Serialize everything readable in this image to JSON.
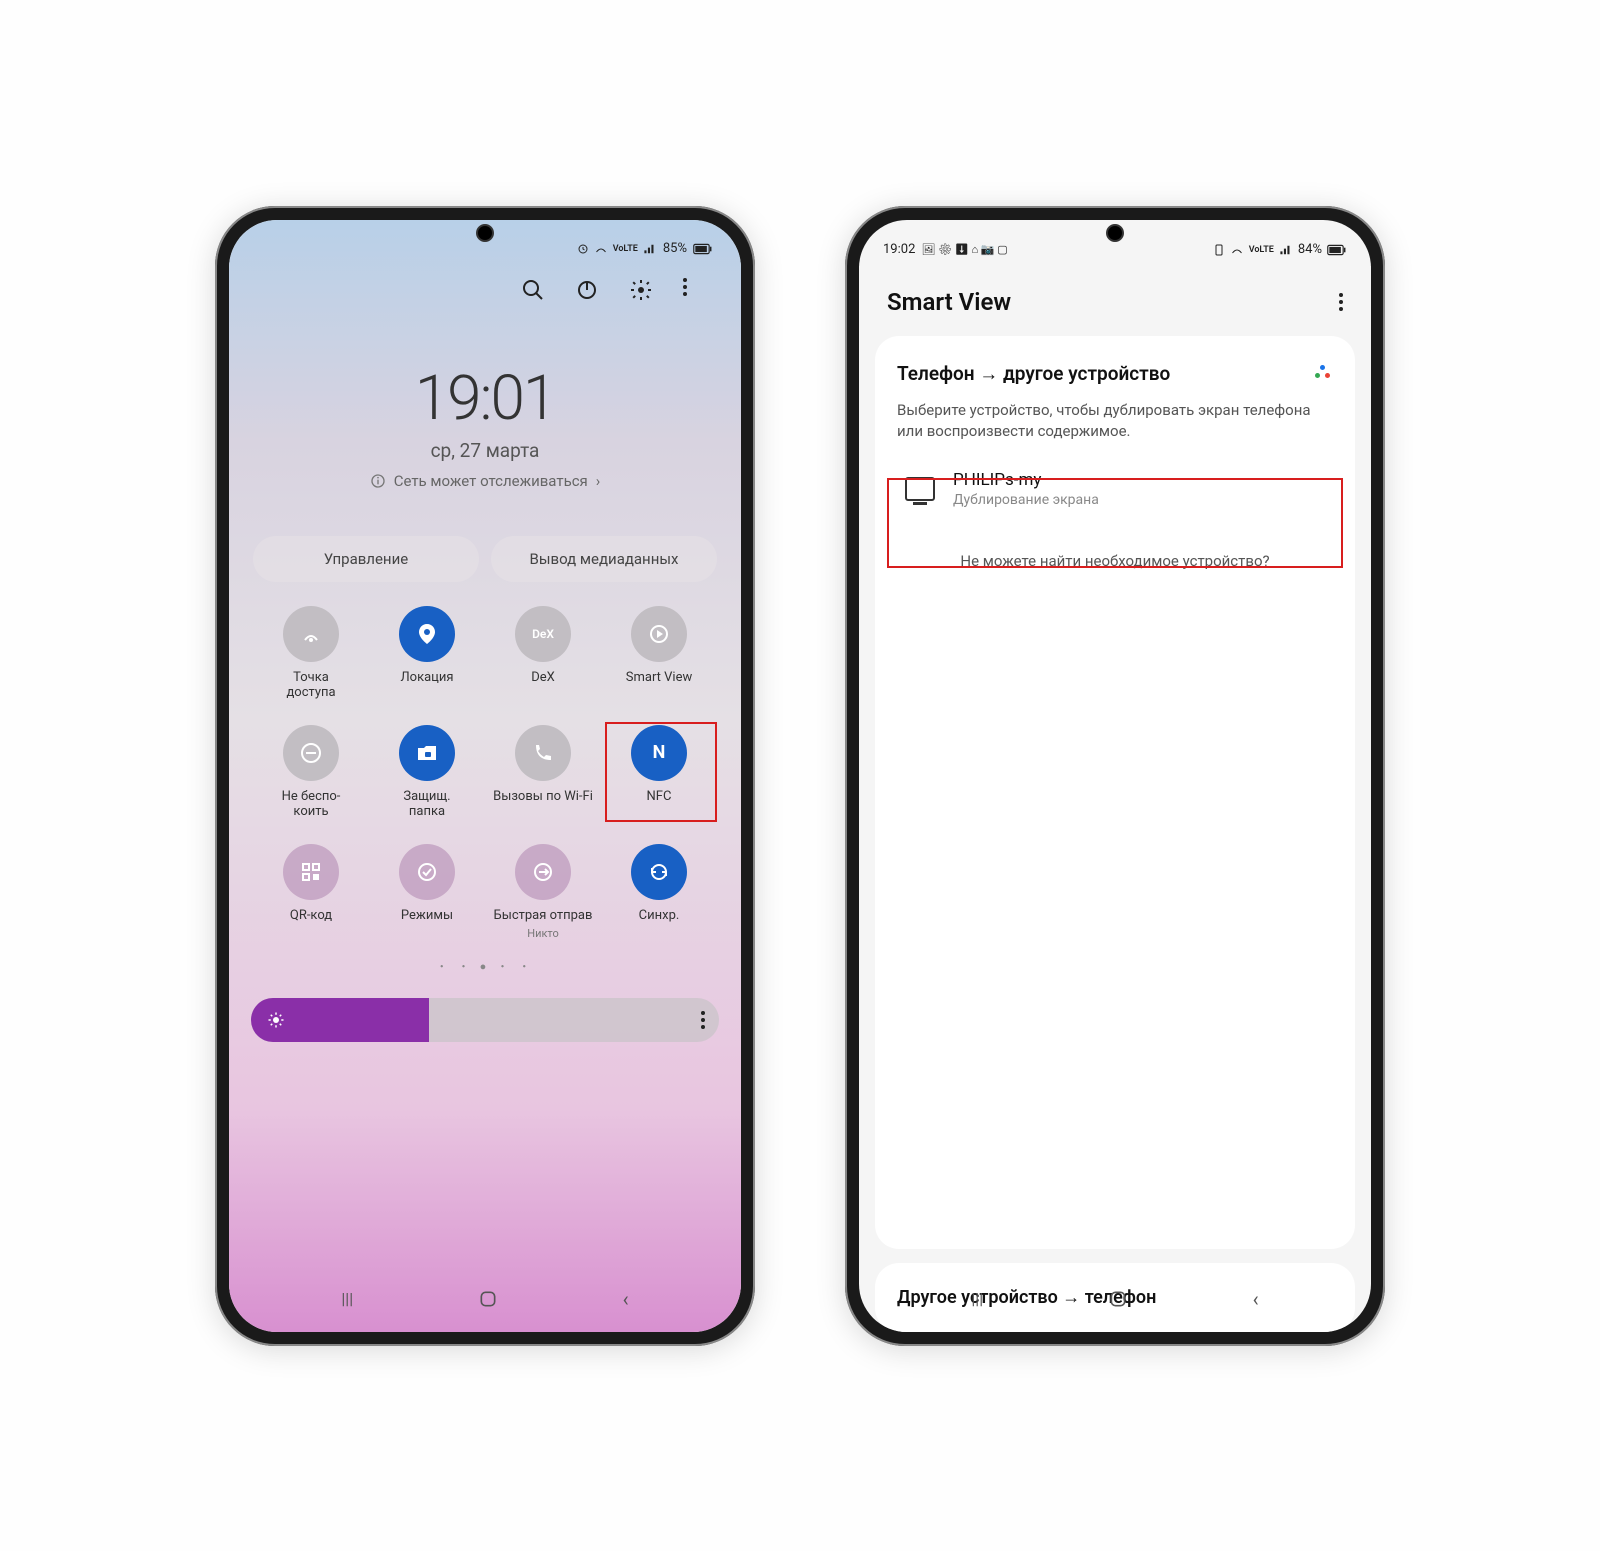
{
  "left": {
    "status": {
      "battery": "85%",
      "indicators": "⏱ 📶 LTE ᯤ ||"
    },
    "clock": {
      "time": "19:01",
      "date": "ср, 27 марта"
    },
    "network_note": "Сеть может отслеживаться",
    "tabs": {
      "manage": "Управление",
      "media": "Вывод медиаданных"
    },
    "tiles": {
      "hotspot": "Точка\nдоступа",
      "location": "Локация",
      "dex": "DeX",
      "smartview": "Smart View",
      "dnd": "Не беспо-\nкоить",
      "secure": "Защищ.\nпапка",
      "wificall": "Вызовы по Wi-Fi",
      "nfc": "NFC",
      "qr": "QR-код",
      "modes": "Режимы",
      "quick": "Быстрая отправ",
      "quick_sub": "Никто",
      "sync": "Синхр."
    }
  },
  "right": {
    "status": {
      "time": "19:02",
      "battery": "84%"
    },
    "title": "Smart View",
    "section1": "Телефон → другое устройство",
    "desc": "Выберите устройство, чтобы дублировать экран телефона или воспроизвести содержимое.",
    "device_name": "PHILIPs-my",
    "device_sub": "Дублирование экрана",
    "help": "Не можете найти необходимое устройство?",
    "section2": "Другое устройство → телефон"
  }
}
